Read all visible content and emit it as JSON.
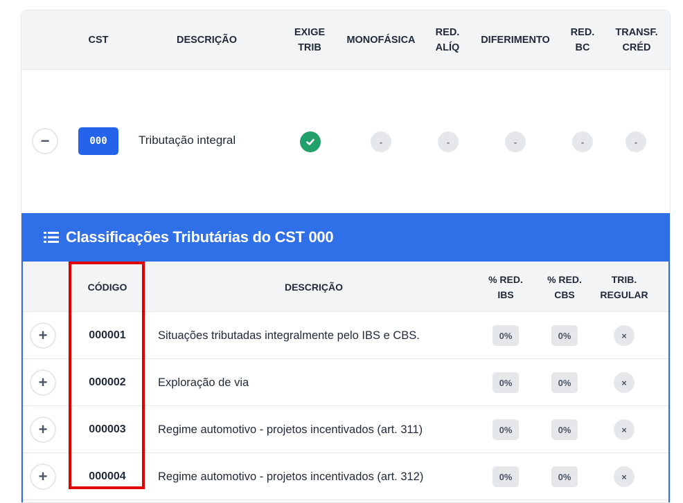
{
  "outer_table": {
    "headers": {
      "cst": "CST",
      "descricao": "DESCRIÇÃO",
      "exige_trib": "EXIGE\nTRIB",
      "monofasica": "MONOFÁSICA",
      "red_aliq": "RED.\nALÍQ",
      "diferimento": "DIFERIMENTO",
      "red_bc": "RED.\nBC",
      "transf_cred": "TRANSF.\nCRÉD"
    },
    "row": {
      "collapse_symbol": "−",
      "code": "000",
      "description": "Tributação integral",
      "dash": "-"
    }
  },
  "inner_panel": {
    "title": "Classificações Tributárias do CST 000",
    "headers": {
      "codigo": "CÓDIGO",
      "descricao": "DESCRIÇÃO",
      "red_ibs": "% RED.\nIBS",
      "red_cbs": "% RED.\nCBS",
      "trib_regular": "TRIB.\nREGULAR"
    },
    "rows": [
      {
        "code": "000001",
        "description": "Situações tributadas integralmente pelo IBS e CBS.",
        "red_ibs": "0%",
        "red_cbs": "0%",
        "trib_regular": "×",
        "expand": "+"
      },
      {
        "code": "000002",
        "description": "Exploração de via",
        "red_ibs": "0%",
        "red_cbs": "0%",
        "trib_regular": "×",
        "expand": "+"
      },
      {
        "code": "000003",
        "description": "Regime automotivo - projetos incentivados (art. 311)",
        "red_ibs": "0%",
        "red_cbs": "0%",
        "trib_regular": "×",
        "expand": "+"
      },
      {
        "code": "000004",
        "description": "Regime automotivo - projetos incentivados (art. 312)",
        "red_ibs": "0%",
        "red_cbs": "0%",
        "trib_regular": "×",
        "expand": "+"
      }
    ]
  },
  "colors": {
    "accent_blue": "#2f6fe8",
    "badge_blue": "#2563eb",
    "success_green": "#22a06b",
    "highlight_red": "#e00000"
  }
}
